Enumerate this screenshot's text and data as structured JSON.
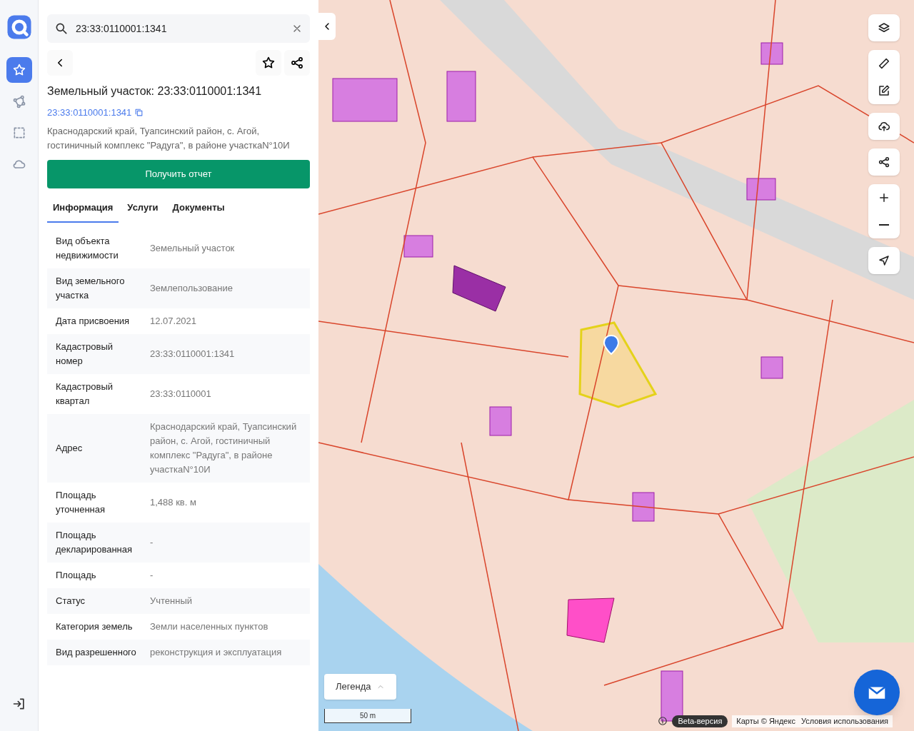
{
  "rail": {
    "items": [
      {
        "kind": "favorites",
        "selected": true
      },
      {
        "kind": "polygon",
        "selected": false
      },
      {
        "kind": "selection",
        "selected": false
      },
      {
        "kind": "cloud",
        "selected": false
      }
    ]
  },
  "search": {
    "value": "23:33:0110001:1341"
  },
  "object": {
    "title": "Земельный участок: 23:33:0110001:1341",
    "cadastral_link": "23:33:0110001:1341",
    "address": "Краснодарский край, Туапсинский район, с. Агой, гостиничный комплекс \"Радуга\", в районе участкаN°10И"
  },
  "report_button": "Получить отчет",
  "tabs": [
    {
      "label": "Информация",
      "selected": true
    },
    {
      "label": "Услуги",
      "selected": false
    },
    {
      "label": "Документы",
      "selected": false
    }
  ],
  "properties": [
    {
      "label": "Вид объекта недвижимости",
      "value": "Земельный участок"
    },
    {
      "label": "Вид земельного участка",
      "value": "Землепользование"
    },
    {
      "label": "Дата присвоения",
      "value": "12.07.2021"
    },
    {
      "label": "Кадастровый номер",
      "value": "23:33:0110001:1341"
    },
    {
      "label": "Кадастровый квартал",
      "value": "23:33:0110001"
    },
    {
      "label": "Адрес",
      "value": "Краснодарский край, Туапсинский район, с. Агой, гостиничный комплекс \"Радуга\", в районе участкаN°10И"
    },
    {
      "label": "Площадь уточненная",
      "value": "1,488 кв. м"
    },
    {
      "label": "Площадь декларированная",
      "value": "-"
    },
    {
      "label": "Площадь",
      "value": "-"
    },
    {
      "label": "Статус",
      "value": "Учтенный"
    },
    {
      "label": "Категория земель",
      "value": "Земли населенных пунктов"
    },
    {
      "label": "Вид разрешенного",
      "value": "реконструкция и эксплуатация"
    }
  ],
  "map": {
    "legend": "Легенда",
    "scale": "50 m",
    "beta": "Beta-версия",
    "copyright": "Карты © Яндекс",
    "terms": "Условия использования"
  }
}
